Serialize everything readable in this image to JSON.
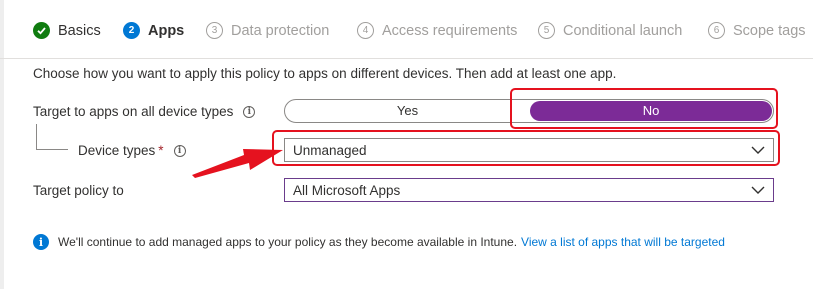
{
  "wizard": {
    "steps": [
      {
        "number": "",
        "label": "Basics",
        "status": "completed"
      },
      {
        "number": "2",
        "label": "Apps",
        "status": "current"
      },
      {
        "number": "3",
        "label": "Data protection",
        "status": "pending"
      },
      {
        "number": "4",
        "label": "Access requirements",
        "status": "pending"
      },
      {
        "number": "5",
        "label": "Conditional launch",
        "status": "pending"
      },
      {
        "number": "6",
        "label": "Scope tags",
        "status": "pending"
      }
    ]
  },
  "form": {
    "description": "Choose how you want to apply this policy to apps on different devices. Then add at least one app.",
    "target_all_devices": {
      "label": "Target to apps on all device types",
      "options": [
        "Yes",
        "No"
      ],
      "selected": "No"
    },
    "device_types": {
      "label": "Device types",
      "required_marker": "*",
      "value": "Unmanaged"
    },
    "target_policy": {
      "label": "Target policy to",
      "value": "All Microsoft Apps"
    }
  },
  "info": {
    "icon": "info-icon",
    "text": "We'll continue to add managed apps to your policy as they become available in Intune.",
    "link": "View a list of apps that will be targeted"
  },
  "colors": {
    "accent": "#0078d4",
    "toggle_selected": "#7c2b97",
    "annotation": "#e5121f",
    "success": "#107c10"
  }
}
